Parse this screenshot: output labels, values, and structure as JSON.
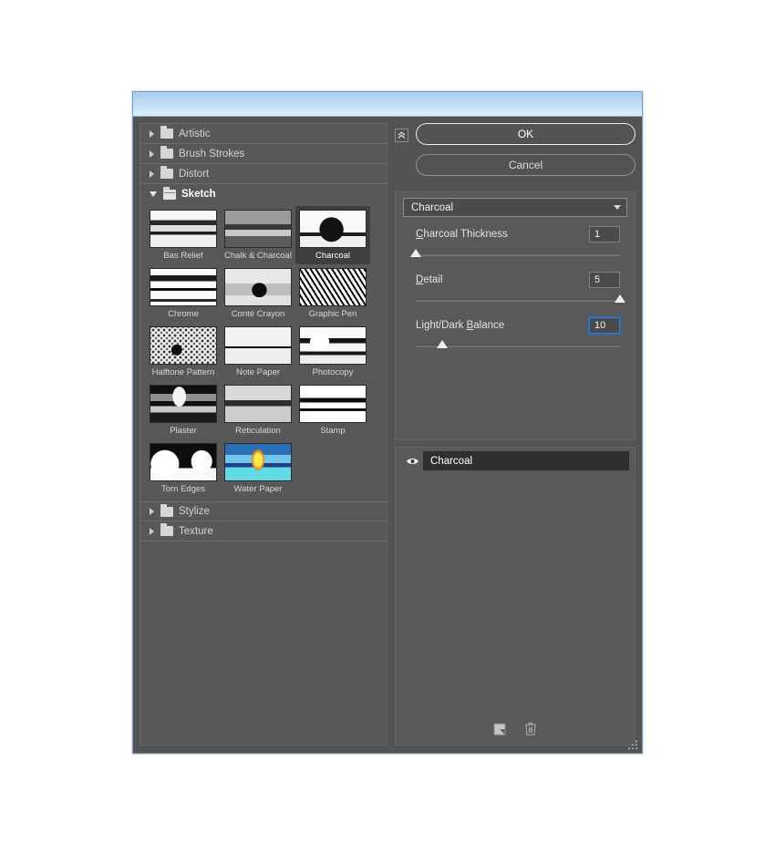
{
  "window": {
    "title": "",
    "collapse_icon": "double-chevron-up-icon",
    "resize_grip": "resize-grip"
  },
  "buttons": {
    "ok": "OK",
    "cancel": "Cancel"
  },
  "browser": {
    "categories": [
      {
        "label": "Artistic",
        "expanded": false,
        "icon": "folder-icon"
      },
      {
        "label": "Brush Strokes",
        "expanded": false,
        "icon": "folder-icon"
      },
      {
        "label": "Distort",
        "expanded": false,
        "icon": "folder-icon"
      },
      {
        "label": "Sketch",
        "expanded": true,
        "icon": "folder-open-icon"
      },
      {
        "label": "Stylize",
        "expanded": false,
        "icon": "folder-icon"
      },
      {
        "label": "Texture",
        "expanded": false,
        "icon": "folder-icon"
      }
    ],
    "filters": [
      {
        "label": "Bas Relief",
        "selected": false,
        "tex": "t-bas"
      },
      {
        "label": "Chalk & Charcoal",
        "selected": false,
        "tex": "t-chalk"
      },
      {
        "label": "Charcoal",
        "selected": true,
        "tex": "t-char"
      },
      {
        "label": "Chrome",
        "selected": false,
        "tex": "t-chrome"
      },
      {
        "label": "Conté Crayon",
        "selected": false,
        "tex": "t-conte"
      },
      {
        "label": "Graphic Pen",
        "selected": false,
        "tex": "t-gpen"
      },
      {
        "label": "Halftone Pattern",
        "selected": false,
        "tex": "t-half"
      },
      {
        "label": "Note Paper",
        "selected": false,
        "tex": "t-note"
      },
      {
        "label": "Photocopy",
        "selected": false,
        "tex": "t-photo"
      },
      {
        "label": "Plaster",
        "selected": false,
        "tex": "t-plast"
      },
      {
        "label": "Reticulation",
        "selected": false,
        "tex": "t-retic"
      },
      {
        "label": "Stamp",
        "selected": false,
        "tex": "t-stamp"
      },
      {
        "label": "Torn Edges",
        "selected": false,
        "tex": "t-torn"
      },
      {
        "label": "Water Paper",
        "selected": false,
        "tex": "t-water"
      }
    ]
  },
  "params": {
    "filter_select": "Charcoal",
    "dropdown_icon": "chevron-down-icon",
    "controls": [
      {
        "label_pre": "C",
        "label_post": "harcoal Thickness",
        "value": "1",
        "percent": 0,
        "focused": false
      },
      {
        "label_pre": "D",
        "label_post": "etail",
        "value": "5",
        "percent": 100,
        "focused": false
      },
      {
        "label_pre": "Light/Dark ",
        "label_post": "Balance",
        "value": "10",
        "percent": 13,
        "focused": true,
        "underline_at": "B"
      }
    ]
  },
  "layers": {
    "items": [
      {
        "name": "Charcoal",
        "visible": true,
        "visibility_icon": "eye-icon"
      }
    ],
    "tools": [
      {
        "name": "new-effect-layer-icon"
      },
      {
        "name": "delete-effect-layer-icon"
      }
    ]
  },
  "colors": {
    "window_bg": "#535353",
    "panel_bg": "#595959",
    "titlebar": "#bedbf6",
    "accent_focus": "#2f7fd8",
    "text": "#e2e2e2",
    "selected_item": "#3e3e3e"
  }
}
